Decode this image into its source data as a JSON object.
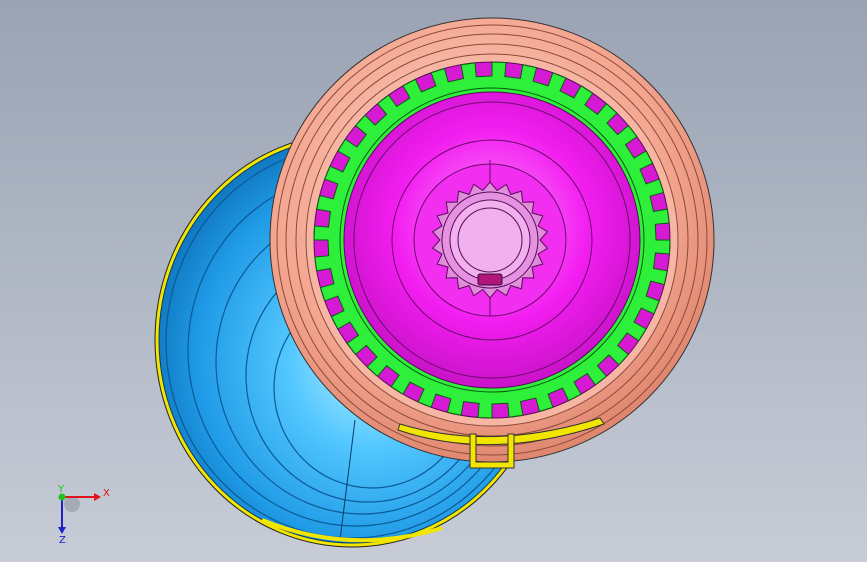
{
  "viewport": {
    "background_top": "#9aa3b4",
    "background_bottom": "#c7ccd6"
  },
  "model": {
    "parts": [
      {
        "name": "rear-housing",
        "color": "#2aa8f0",
        "role": "blue bowl-shaped housing"
      },
      {
        "name": "rear-housing-rim",
        "color": "#f2e600",
        "role": "yellow rim edge"
      },
      {
        "name": "outer-ring",
        "color": "#f3a48e",
        "role": "salmon outer flange"
      },
      {
        "name": "gear-ring",
        "color": "#2ef03a",
        "role": "green toothed ring"
      },
      {
        "name": "hub-disc",
        "color": "#f21df0",
        "role": "magenta hub disc"
      },
      {
        "name": "inner-spline",
        "color": "#e48ce0",
        "role": "pink splined bore"
      },
      {
        "name": "clip",
        "color": "#f2e600",
        "role": "yellow retaining clip"
      }
    ],
    "gear_teeth_outer": 36,
    "spline_teeth_inner": 22
  },
  "triad": {
    "x_label": "X",
    "y_label": "Y",
    "z_label": "Z",
    "x_color": "#e0151b",
    "y_color": "#1ec41e",
    "z_color": "#2020c8"
  }
}
